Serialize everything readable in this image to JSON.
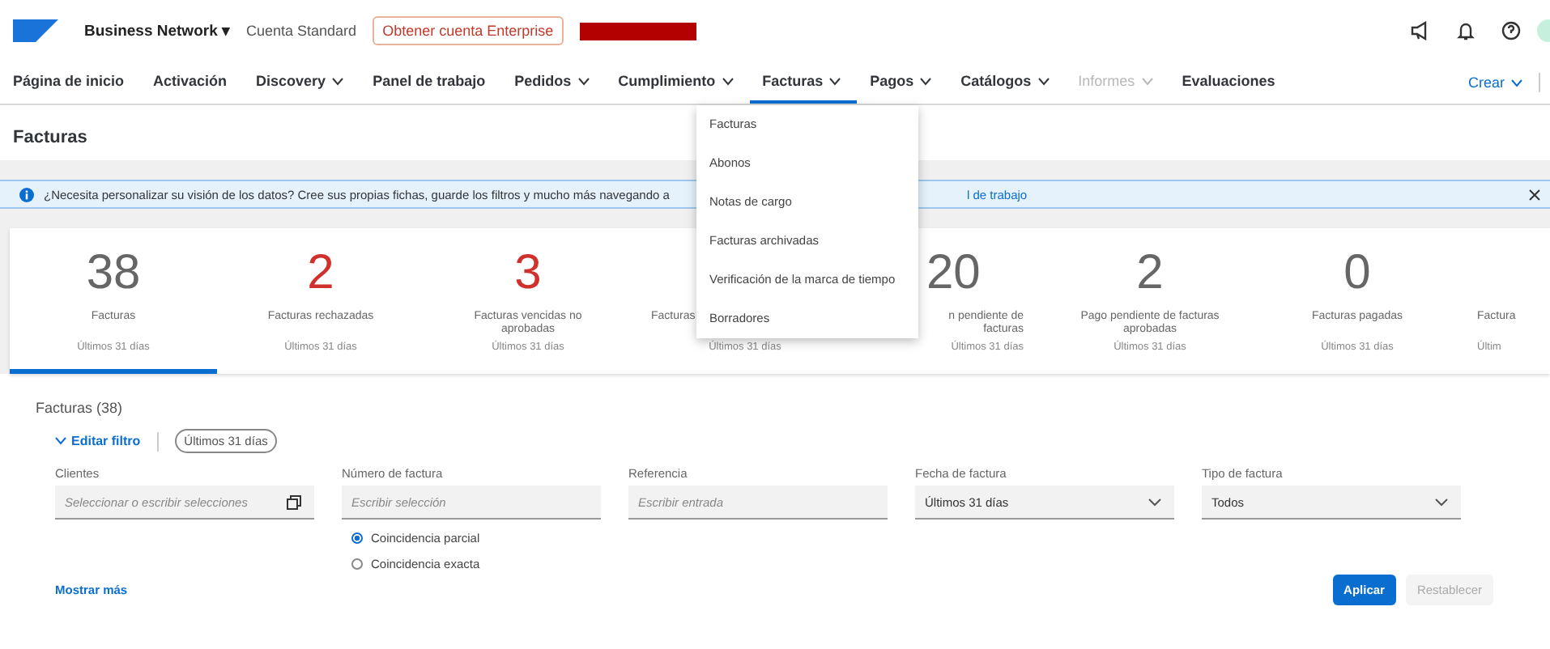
{
  "top_bar": {
    "product": "Business Network",
    "product_caret": "▾",
    "account": "Cuenta Standard",
    "upgrade_button": "Obtener cuenta Enterprise"
  },
  "nav": {
    "items": [
      {
        "label": "Página de inicio",
        "dropdown": false,
        "selected": false,
        "disabled": false
      },
      {
        "label": "Activación",
        "dropdown": false,
        "selected": false,
        "disabled": false
      },
      {
        "label": "Discovery",
        "dropdown": true,
        "selected": false,
        "disabled": false
      },
      {
        "label": "Panel de trabajo",
        "dropdown": false,
        "selected": false,
        "disabled": false
      },
      {
        "label": "Pedidos",
        "dropdown": true,
        "selected": false,
        "disabled": false
      },
      {
        "label": "Cumplimiento",
        "dropdown": true,
        "selected": false,
        "disabled": false
      },
      {
        "label": "Facturas",
        "dropdown": true,
        "selected": true,
        "disabled": false
      },
      {
        "label": "Pagos",
        "dropdown": true,
        "selected": false,
        "disabled": false
      },
      {
        "label": "Catálogos",
        "dropdown": true,
        "selected": false,
        "disabled": false
      },
      {
        "label": "Informes",
        "dropdown": true,
        "selected": false,
        "disabled": true
      },
      {
        "label": "Evaluaciones",
        "dropdown": false,
        "selected": false,
        "disabled": false
      }
    ],
    "create": "Crear"
  },
  "menu": {
    "items": [
      "Facturas",
      "Abonos",
      "Notas de cargo",
      "Facturas archivadas",
      "Verificación de la marca de tiempo",
      "Borradores"
    ]
  },
  "page_title": "Facturas",
  "banner": {
    "text": "¿Necesita personalizar su visión de los datos? Cree sus propias fichas, guarde los filtros y mucho más navegando a",
    "link_tail": "l de trabajo"
  },
  "tiles": [
    {
      "kind": "full",
      "count": "38",
      "color": "#666666",
      "label": "Facturas",
      "period": "Últimos 31 días",
      "selected": true
    },
    {
      "kind": "full",
      "count": "2",
      "color": "#d0312d",
      "label": "Facturas rechazadas",
      "period": "Últimos 31 días",
      "selected": false
    },
    {
      "kind": "full",
      "count": "3",
      "color": "#d0312d",
      "label": "Facturas vencidas no aprobadas",
      "period": "Últimos 31 días",
      "selected": false
    },
    {
      "kind": "covered-right",
      "label": "Facturas",
      "period": "Últimos 31 días",
      "selected": false
    },
    {
      "kind": "covered-left",
      "count": "20",
      "color": "#666666",
      "label": "n pendiente de facturas",
      "period": "Últimos 31 días",
      "selected": false
    },
    {
      "kind": "full",
      "count": "2",
      "color": "#666666",
      "label": "Pago pendiente de facturas aprobadas",
      "period": "Últimos 31 días",
      "selected": false
    },
    {
      "kind": "full",
      "count": "0",
      "color": "#666666",
      "label": "Facturas pagadas",
      "period": "Últimos 31 días",
      "selected": false
    },
    {
      "kind": "edge",
      "label": "Factura",
      "period": "Últim",
      "selected": false
    }
  ],
  "filters": {
    "heading": "Facturas (38)",
    "edit_filter": "Editar filtro",
    "active_chip": "Últimos 31 días",
    "fields": [
      {
        "kind": "multi",
        "label": "Clientes",
        "placeholder": "Seleccionar o escribir selecciones"
      },
      {
        "kind": "text",
        "label": "Número de factura",
        "placeholder": "Escribir selección",
        "options": [
          {
            "label": "Coincidencia parcial",
            "selected": true
          },
          {
            "label": "Coincidencia exacta",
            "selected": false
          }
        ]
      },
      {
        "kind": "text",
        "label": "Referencia",
        "placeholder": "Escribir entrada"
      },
      {
        "kind": "select",
        "label": "Fecha de factura",
        "value": "Últimos 31 días"
      },
      {
        "kind": "select",
        "label": "Tipo de factura",
        "value": "Todos"
      }
    ],
    "show_more": "Mostrar más",
    "apply": "Aplicar",
    "reset": "Restablecer"
  }
}
